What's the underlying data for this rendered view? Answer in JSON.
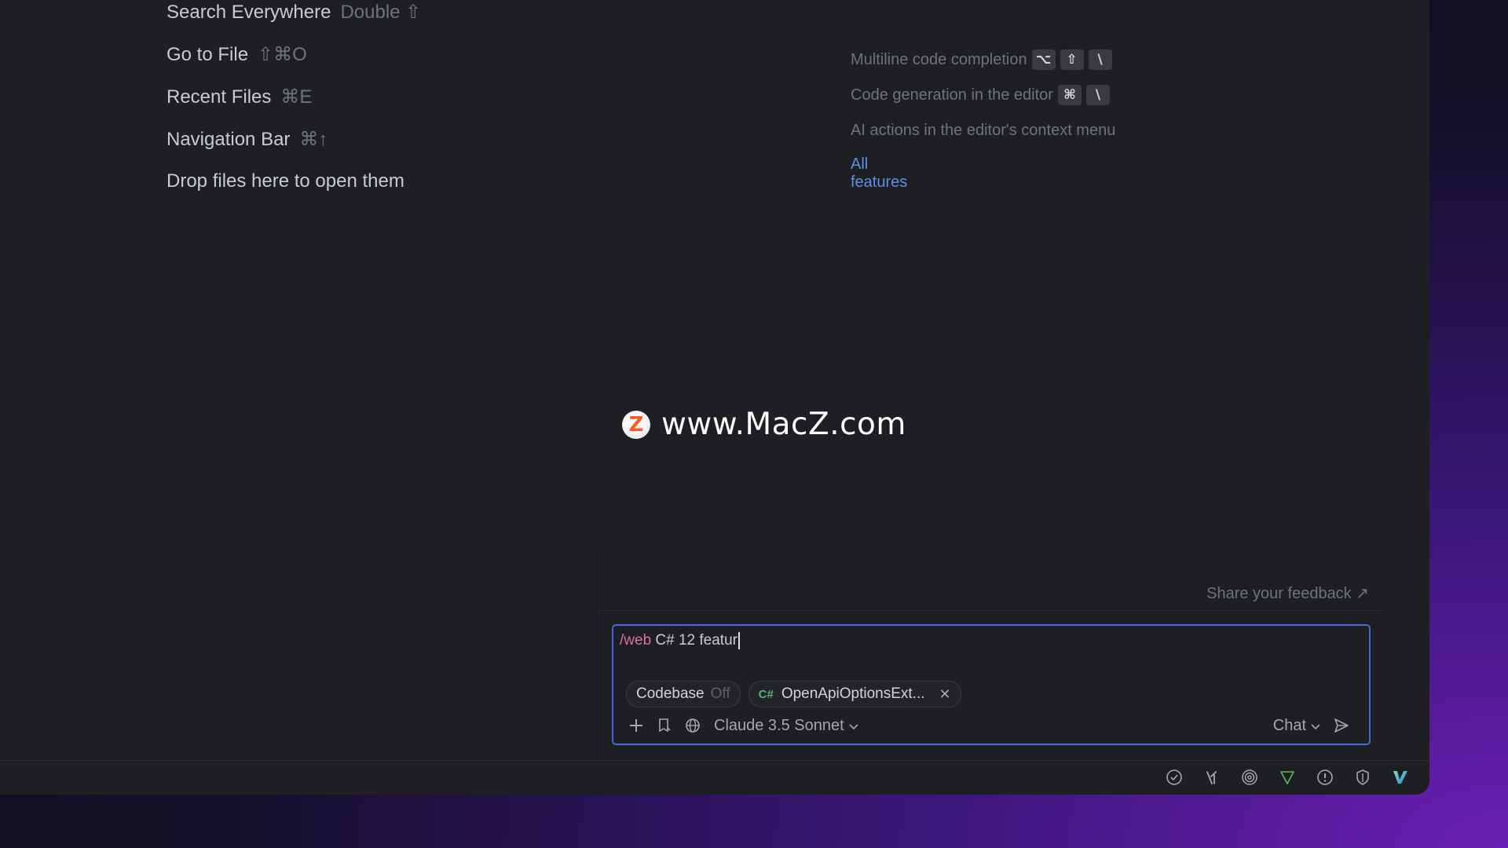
{
  "shortcuts": [
    {
      "label": "Search Everywhere",
      "key": "Double ⇧"
    },
    {
      "label": "Go to File",
      "key": "⇧⌘O"
    },
    {
      "label": "Recent Files",
      "key": "⌘E"
    },
    {
      "label": "Navigation Bar",
      "key": "⌘↑"
    }
  ],
  "drop_hint": "Drop files here to open them",
  "features": [
    {
      "label": "Multiline code completion",
      "keys": [
        "⌥",
        "⇧",
        "\\"
      ]
    },
    {
      "label": "Code generation in the editor",
      "keys": [
        "⌘",
        "\\"
      ]
    },
    {
      "label": "AI actions in the editor's context menu"
    }
  ],
  "all_features_link": "All features",
  "watermark": {
    "logo_letter": "Z",
    "text": "www.MacZ.com"
  },
  "chat": {
    "feedback_link": "Share your feedback ↗",
    "input": {
      "command": "/web",
      "text": " C# 12 featur"
    },
    "chips": {
      "codebase": {
        "label": "Codebase",
        "state": "Off"
      },
      "file": {
        "lang": "C#",
        "name": "OpenApiOptionsExt...",
        "close": "✕"
      }
    },
    "model": "Claude 3.5 Sonnet",
    "mode": "Chat"
  },
  "colors": {
    "accent": "#3d6bdb",
    "link": "#5d8ee8",
    "command": "#d7739a",
    "brand_green": "#4fc3f7"
  },
  "status_icons": [
    "check-circle-icon",
    "ai-assistant-icon",
    "spiral-icon",
    "triangle-icon",
    "warning-icon",
    "shield-icon",
    "v-logo-icon"
  ]
}
